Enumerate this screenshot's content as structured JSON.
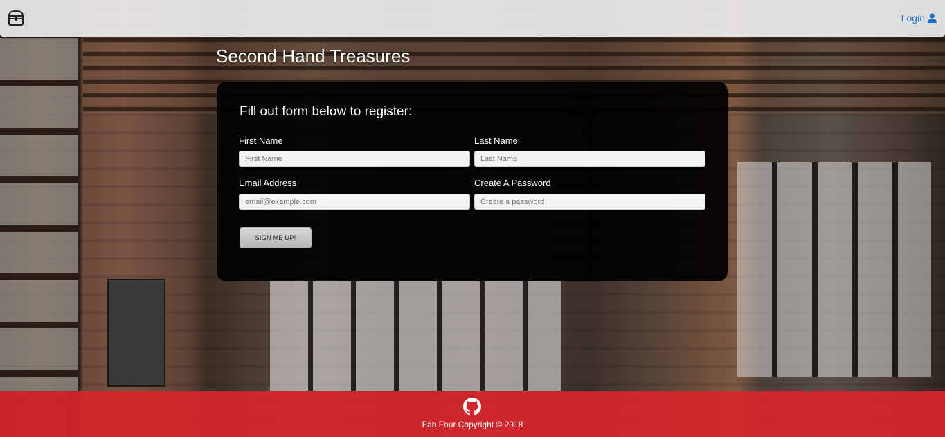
{
  "navbar": {
    "logo_icon": "treasure-chest-icon",
    "login_label": "Login",
    "login_icon": "user-icon"
  },
  "site_title": "Second Hand Treasures",
  "form": {
    "heading": "Fill out form below to register:",
    "first_name": {
      "label": "First Name",
      "placeholder": "First Name",
      "value": ""
    },
    "last_name": {
      "label": "Last Name",
      "placeholder": "Last Name",
      "value": ""
    },
    "email": {
      "label": "Email Address",
      "placeholder": "email@example.com",
      "value": ""
    },
    "password": {
      "label": "Create A Password",
      "placeholder": "Create a password",
      "value": ""
    },
    "submit_label": "SIGN ME UP!"
  },
  "footer": {
    "icon": "github-icon",
    "copyright": "Fab Four Copyright © 2018"
  },
  "colors": {
    "footer": "#d7262a",
    "link": "#1a73c8",
    "panel": "#000000"
  }
}
